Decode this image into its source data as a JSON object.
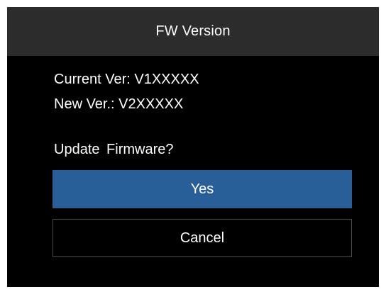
{
  "dialog": {
    "title": "FW Version",
    "current_version": "Current Ver: V1XXXXX",
    "new_version": "New Ver.: V2XXXXX",
    "question": "Update  Firmware?",
    "yes_label": "Yes",
    "cancel_label": "Cancel"
  },
  "colors": {
    "background": "#000000",
    "title_bar": "#2c2c2c",
    "selected_button": "#285f98",
    "button_border": "#4a4a4a",
    "text": "#ffffff"
  }
}
